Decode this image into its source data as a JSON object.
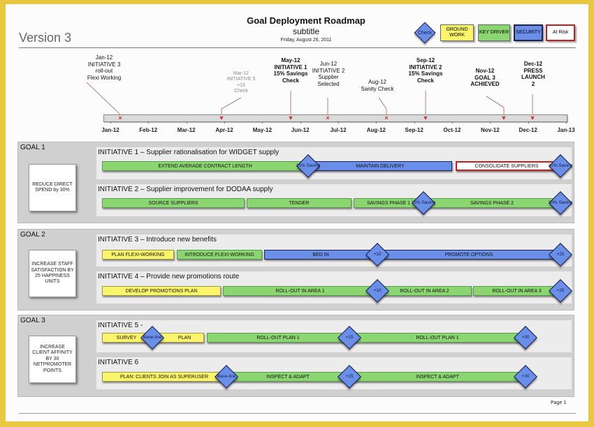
{
  "header": {
    "version": "Version 3",
    "title": "Goal Deployment Roadmap",
    "subtitle": "subtitle",
    "date": "Friday, August 26, 2011"
  },
  "legend": {
    "check": "Check",
    "ground_work": "GROUND WORK",
    "key_driver": "KEY DRIVER",
    "security": "SECURITY",
    "at_risk": "At Risk"
  },
  "colors": {
    "ground_work": "#faf56a",
    "key_driver": "#8bd670",
    "security": "#6a8fe8",
    "at_risk": "#c02020",
    "page_border": "#e8c840"
  },
  "timeline": {
    "months": [
      "Jan-12",
      "Feb-12",
      "Mar-12",
      "Apr-12",
      "May-12",
      "Jun-12",
      "Jul-12",
      "Aug-12",
      "Sep-12",
      "Oct-12",
      "Nov-12",
      "Dec-12",
      "Jan-13"
    ],
    "milestones": [
      {
        "lines": [
          "Jan-12",
          "INITIATIVE 3",
          "roll-out",
          "Flexi Working"
        ],
        "mark": "x",
        "style": "normal"
      },
      {
        "lines": [
          "Mar-12",
          "INITIATIVE 5",
          "+15",
          "Check"
        ],
        "mark": "arrow",
        "style": "faded"
      },
      {
        "lines": [
          "May-12",
          "INITIATIVE 1",
          "15% Savings",
          "Check"
        ],
        "mark": "arrow",
        "style": "bold"
      },
      {
        "lines": [
          "Jun-12",
          "INITIATIVE 2",
          "Supplier",
          "Selected"
        ],
        "mark": "x",
        "style": "normal"
      },
      {
        "lines": [
          "Aug-12",
          "Sanity Check"
        ],
        "mark": "x",
        "style": "normal"
      },
      {
        "lines": [
          "Sep-12",
          "INITIATIVE 2",
          "15% Savings",
          "Check"
        ],
        "mark": "arrow",
        "style": "bold"
      },
      {
        "lines": [
          "Nov-12",
          "GOAL 3",
          "ACHIEVED"
        ],
        "mark": "arrow",
        "style": "bold"
      },
      {
        "lines": [
          "Dec-12",
          "PRESS",
          "LAUNCH",
          "2"
        ],
        "mark": "arrow",
        "style": "bold"
      }
    ]
  },
  "goals": [
    {
      "label": "GOAL 1",
      "objective": "REDUCE DIRECT SPEND by 30%",
      "initiatives": [
        {
          "title": "INITIATIVE 1 – Supplier rationalisation for WIDGET supply",
          "tasks": [
            {
              "label": "EXTEND AVERAGE CONTRACT LENGTH",
              "type": "green"
            },
            {
              "label": "MAINTAIN DELIVERY",
              "type": "blue"
            },
            {
              "label": "CONSOLIDATE SUPPLIERS",
              "type": "risk"
            }
          ],
          "checks": [
            "15% Saving",
            "30% Saving"
          ]
        },
        {
          "title": "INITIATIVE 2 – Supplier improvement for DODAA supply",
          "tasks": [
            {
              "label": "SOURCE SUPPLIERS",
              "type": "green"
            },
            {
              "label": "TENDER",
              "type": "green"
            },
            {
              "label": "SAVINGS PHASE 1",
              "type": "green"
            },
            {
              "label": "SAVINGS PHASE 2",
              "type": "green"
            }
          ],
          "checks": [
            "15% Saving",
            "30% Saving"
          ]
        }
      ]
    },
    {
      "label": "GOAL 2",
      "objective": "INCREASE STAFF SATISFACTION BY 25 HAPPINESS UNITS",
      "initiatives": [
        {
          "title": "INITIATIVE 3 – Introduce new benefits",
          "tasks": [
            {
              "label": "PLAN FLEXI-WORKING",
              "type": "yellow"
            },
            {
              "label": "INTRODUCE FLEXI-WORKING",
              "type": "green"
            },
            {
              "label": "BED IN",
              "type": "blue"
            },
            {
              "label": "PROMOTE OPTIONS",
              "type": "blue"
            }
          ],
          "checks": [
            "+10",
            "+25"
          ]
        },
        {
          "title": "INITIATIVE 4 – Provide new promotions route",
          "tasks": [
            {
              "label": "DEVELOP PROMOTIONS PLAN",
              "type": "yellow"
            },
            {
              "label": "ROLL-OUT IN AREA 1",
              "type": "green"
            },
            {
              "label": "ROLL-OUT IN AREA 2",
              "type": "green"
            },
            {
              "label": "ROLL-OUT IN AREA 3",
              "type": "green"
            }
          ],
          "checks": [
            "+10",
            "+25"
          ]
        }
      ]
    },
    {
      "label": "GOAL 3",
      "objective": "INCREASE CLIENT AFFINITY BY 30 NETPROMOTER POINTS",
      "initiatives": [
        {
          "title": "INITIATIVE 5 -",
          "tasks": [
            {
              "label": "SURVEY",
              "type": "yellow"
            },
            {
              "label": "PLAN",
              "type": "yellow"
            },
            {
              "label": "ROLL-OUT PLAN 1",
              "type": "green"
            },
            {
              "label": "ROLL-OUT PLAN 1",
              "type": "green"
            }
          ],
          "checks": [
            "Base-line",
            "+15",
            "+30"
          ]
        },
        {
          "title": "INITIATIVE 6",
          "tasks": [
            {
              "label": "PLAN: CLIENTS JOIN AS SUPERUSER",
              "type": "yellow"
            },
            {
              "label": "INSPECT & ADAPT",
              "type": "green"
            },
            {
              "label": "INSPECT & ADAPT",
              "type": "green"
            }
          ],
          "checks": [
            "Base-line",
            "+15",
            "+30"
          ]
        }
      ]
    }
  ],
  "footer": {
    "page": "Page 1"
  }
}
